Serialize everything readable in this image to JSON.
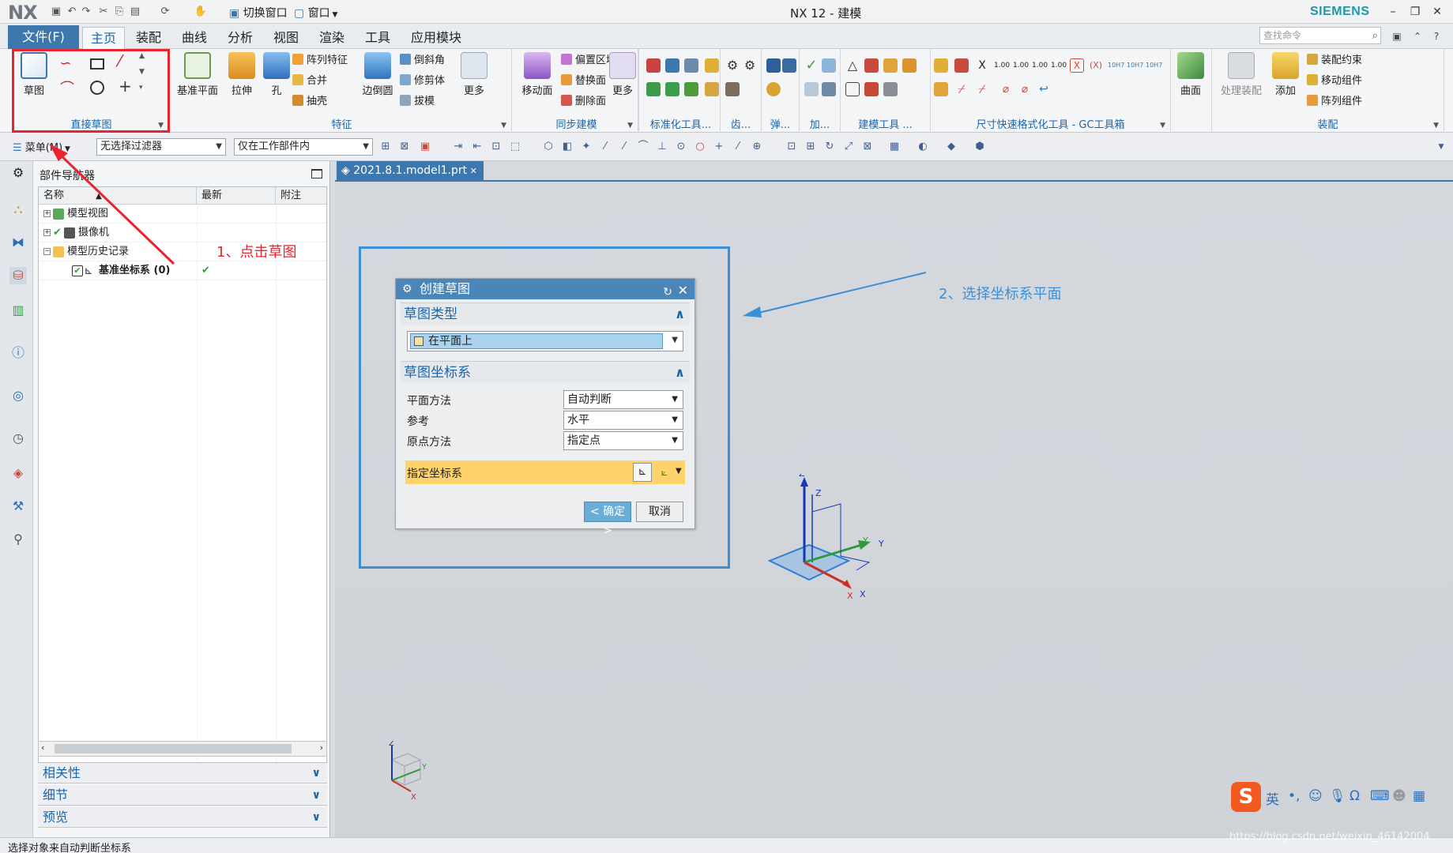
{
  "titlebar": {
    "logo": "NX",
    "switch_window": "切换窗口",
    "window_menu": "窗口",
    "title": "NX 12 - 建模",
    "brand": "SIEMENS"
  },
  "tabs": {
    "file": "文件(F)",
    "items": [
      "主页",
      "装配",
      "曲线",
      "分析",
      "视图",
      "渲染",
      "工具",
      "应用模块"
    ],
    "active": "主页",
    "search_placeholder": "查找命令"
  },
  "ribbon": {
    "sketch": {
      "big_label": "草图",
      "group_label": "直接草图"
    },
    "feature": {
      "datum_plane": "基准平面",
      "extrude": "拉伸",
      "hole": "孔",
      "pattern_feature": "阵列特征",
      "unite": "合并",
      "shell": "抽壳",
      "edge_blend": "边倒圆",
      "chamfer": "倒斜角",
      "trim_body": "修剪体",
      "draft": "拔模",
      "more": "更多",
      "group_label": "特征"
    },
    "sync": {
      "move_face": "移动面",
      "offset_region": "偏置区域",
      "replace_face": "替换面",
      "delete_face": "删除面",
      "more": "更多",
      "group_label": "同步建模"
    },
    "group_standard": "标准化工具...",
    "group_gear": "齿...",
    "group_spring": "弹...",
    "group_add": "加...",
    "group_build": "建模工具 ...",
    "group_dim": "尺寸快速格式化工具 - GC工具箱",
    "surface": "曲面",
    "assembly": {
      "process": "处理装配",
      "add": "添加",
      "constraint": "装配约束",
      "move_component": "移动组件",
      "pattern_component": "阵列组件",
      "group_label": "装配"
    }
  },
  "selbar": {
    "menu": "菜单(M)",
    "filter": "无选择过滤器",
    "scope": "仅在工作部件内"
  },
  "navigator": {
    "title": "部件导航器",
    "columns": [
      "名称",
      "最新",
      "附注"
    ],
    "rows": [
      {
        "label": "模型视图",
        "expand": "+"
      },
      {
        "label": "摄像机",
        "expand": "+"
      },
      {
        "label": "模型历史记录",
        "expand": "−"
      },
      {
        "label": "基准坐标系 (0)",
        "latest": "✔"
      }
    ],
    "accordions": [
      "相关性",
      "细节",
      "预览"
    ]
  },
  "graphics": {
    "tab": "2021.8.1.model1.prt"
  },
  "dialog": {
    "title": "创建草图",
    "section1": "草图类型",
    "sketch_type": "在平面上",
    "section2": "草图坐标系",
    "plane_method_label": "平面方法",
    "plane_method_value": "自动判断",
    "reference_label": "参考",
    "reference_value": "水平",
    "origin_label": "原点方法",
    "origin_value": "指定点",
    "csys_label": "指定坐标系",
    "ok": "< 确定 >",
    "cancel": "取消"
  },
  "annotations": {
    "step1": "1、点击草图",
    "step2": "2、选择坐标系平面"
  },
  "status": "选择对象来自动判断坐标系",
  "watermark": "https://blog.csdn.net/weixin_46142004",
  "ime": {
    "lang": "英"
  },
  "colors": {
    "accent": "#3c78ad",
    "highlight_red": "#e8242e",
    "annot_blue": "#3b8fd6",
    "csys_yellow": "#ffd36b"
  }
}
